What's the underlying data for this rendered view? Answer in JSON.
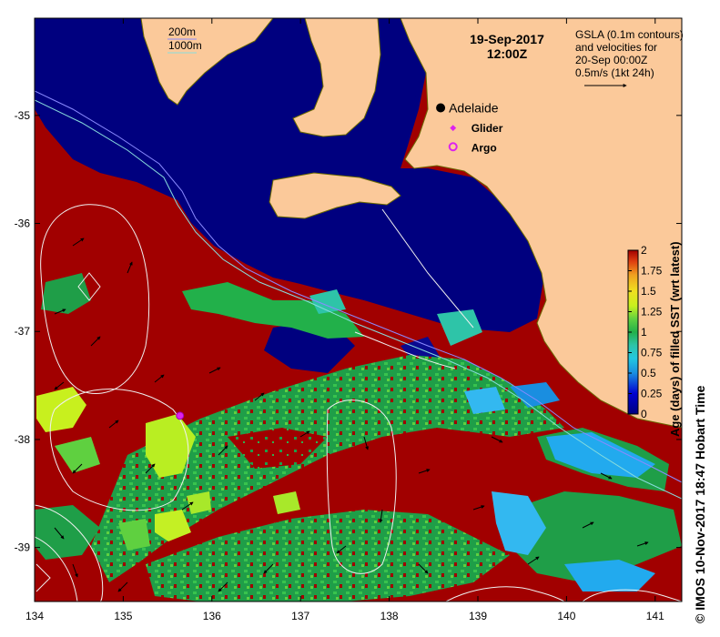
{
  "title": {
    "date": "19-Sep-2017",
    "time": "12:00Z"
  },
  "bathymetry_legend": {
    "line1": "200m",
    "line2": "1000m"
  },
  "velocity_legend": {
    "line1": "GSLA (0.1m contours)",
    "line2": "and velocities for",
    "line3": "20-Sep 00:00Z",
    "line4": "0.5m/s (1kt 24h)"
  },
  "places": {
    "city": {
      "label": "Adelaide",
      "lon": 138.58,
      "lat": -34.93
    },
    "glider": {
      "label": "Glider",
      "lon": 138.72,
      "lat": -35.11
    },
    "argo": {
      "label": "Argo",
      "lon": 138.72,
      "lat": -35.29
    },
    "argo_float": {
      "lon": 135.64,
      "lat": -37.78
    }
  },
  "axes": {
    "x_ticks": [
      "134",
      "135",
      "136",
      "137",
      "138",
      "139",
      "140",
      "141"
    ],
    "y_ticks": [
      "-35",
      "-36",
      "-37",
      "-38",
      "-39"
    ],
    "xlim": [
      134,
      141.3
    ],
    "ylim": [
      -39.5,
      -34.1
    ]
  },
  "colorbar": {
    "label": "Age (days) of filled SST (wrt latest)",
    "ticks": [
      "0",
      "0.25",
      "0.5",
      "0.75",
      "1",
      "1.25",
      "1.5",
      "1.75",
      "2"
    ],
    "range": [
      0,
      2
    ]
  },
  "colors": {
    "land": "#fbc99a",
    "recent": "#00007f",
    "old": "#a10000",
    "mid": "#22b04a"
  },
  "copyright": "© IMOS 10-Nov-2017 18:47 Hobart Time"
}
